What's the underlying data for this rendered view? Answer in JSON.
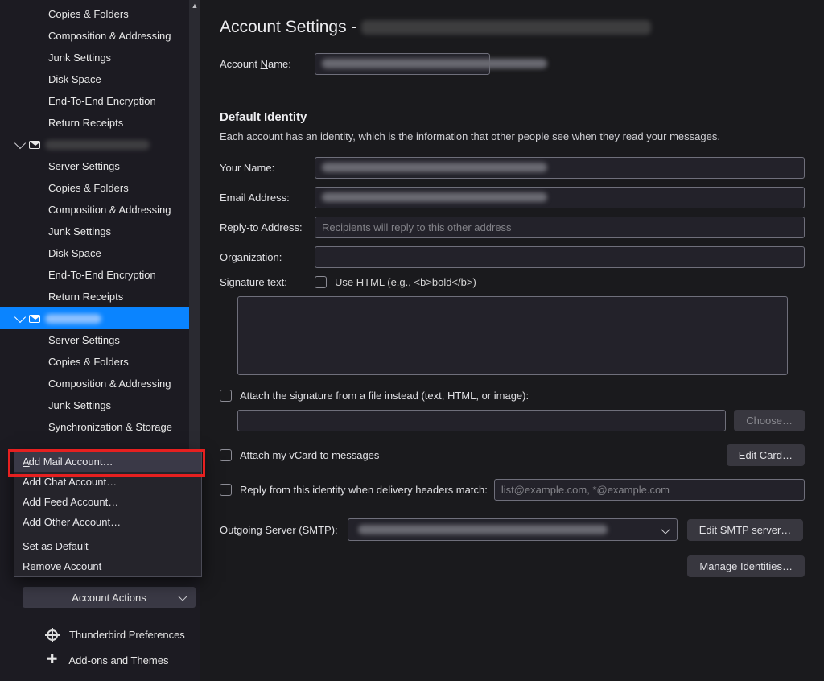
{
  "sidebar": {
    "account1_items": [
      "Copies & Folders",
      "Composition & Addressing",
      "Junk Settings",
      "Disk Space",
      "End-To-End Encryption",
      "Return Receipts"
    ],
    "account2_items": [
      "Server Settings",
      "Copies & Folders",
      "Composition & Addressing",
      "Junk Settings",
      "Disk Space",
      "End-To-End Encryption",
      "Return Receipts"
    ],
    "account3_items": [
      "Server Settings",
      "Copies & Folders",
      "Composition & Addressing",
      "Junk Settings",
      "Synchronization & Storage"
    ],
    "actions_button": "Account Actions",
    "thunderbird_prefs": "Thunderbird Preferences",
    "addons": "Add-ons and Themes"
  },
  "context_menu": {
    "add_mail": "Add Mail Account…",
    "add_chat": "Add Chat Account…",
    "add_feed": "Add Feed Account…",
    "add_other": "Add Other Account…",
    "set_default": "Set as Default",
    "remove": "Remove Account"
  },
  "main": {
    "title_prefix": "Account Settings - ",
    "account_name_label": "Account Name:",
    "default_identity_heading": "Default Identity",
    "default_identity_sub": "Each account has an identity, which is the information that other people see when they read your messages.",
    "your_name_label": "Your Name:",
    "email_label": "Email Address:",
    "replyto_label": "Reply-to Address:",
    "replyto_placeholder": "Recipients will reply to this other address",
    "org_label": "Organization:",
    "sig_label": "Signature text:",
    "use_html_label": "Use HTML (e.g., <b>bold</b>)",
    "attach_file_label": "Attach the signature from a file instead (text, HTML, or image):",
    "choose_btn": "Choose…",
    "attach_vcard_label": "Attach my vCard to messages",
    "edit_card_btn": "Edit Card…",
    "reply_identity_label": "Reply from this identity when delivery headers match:",
    "reply_identity_placeholder": "list@example.com, *@example.com",
    "smtp_label": "Outgoing Server (SMTP):",
    "edit_smtp_btn": "Edit SMTP server…",
    "manage_identities_btn": "Manage Identities…"
  }
}
